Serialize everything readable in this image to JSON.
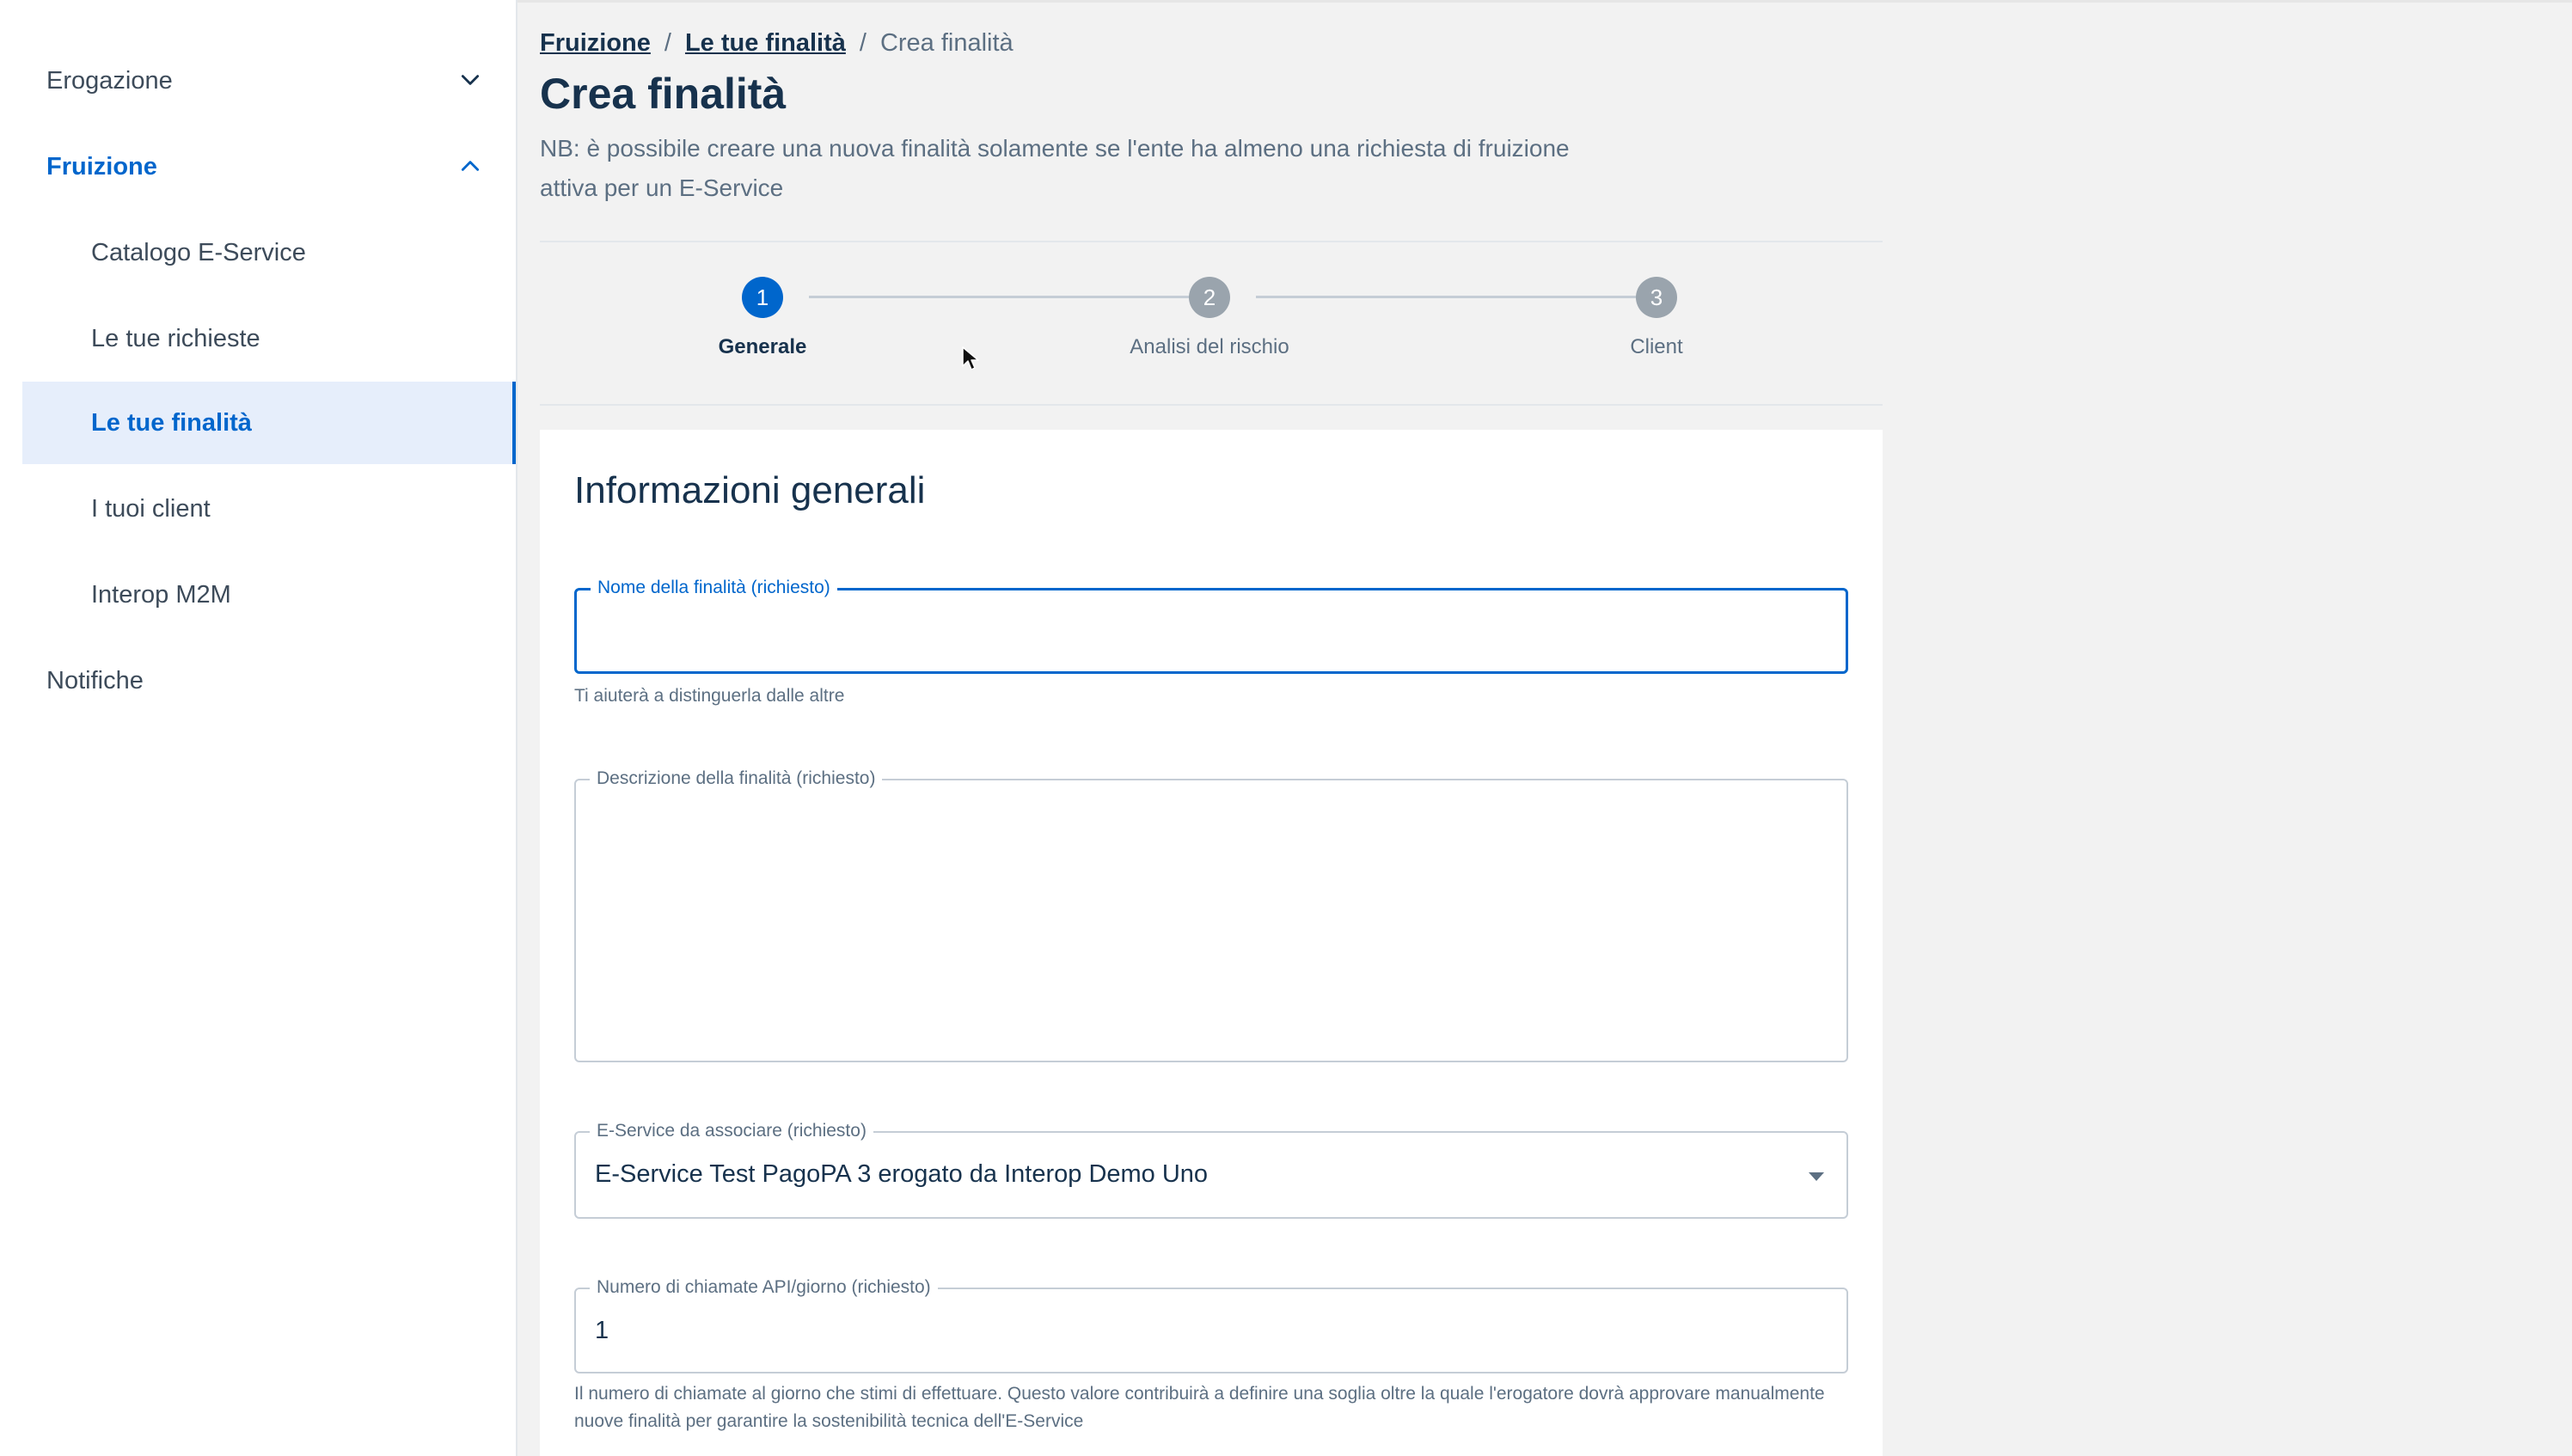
{
  "sidebar": {
    "items": [
      {
        "label": "Erogazione"
      },
      {
        "label": "Fruizione"
      },
      {
        "label": "Catalogo E-Service"
      },
      {
        "label": "Le tue richieste"
      },
      {
        "label": "Le tue finalità"
      },
      {
        "label": "I tuoi client"
      },
      {
        "label": "Interop M2M"
      },
      {
        "label": "Notifiche"
      }
    ]
  },
  "breadcrumb": {
    "items": [
      "Fruizione",
      "Le tue finalità",
      "Crea finalità"
    ],
    "separator": "/"
  },
  "page": {
    "title": "Crea finalità",
    "note": "NB: è possibile creare una nuova finalità solamente se l'ente ha almeno una richiesta di fruizione attiva per un E-Service"
  },
  "stepper": {
    "steps": [
      {
        "number": "1",
        "label": "Generale"
      },
      {
        "number": "2",
        "label": "Analisi del rischio"
      },
      {
        "number": "3",
        "label": "Client"
      }
    ],
    "active_step": 1
  },
  "form": {
    "title": "Informazioni generali",
    "name_field": {
      "label": "Nome della finalità (richiesto)",
      "value": "",
      "helper": "Ti aiuterà a distinguerla dalle altre"
    },
    "description_field": {
      "label": "Descrizione della finalità (richiesto)",
      "value": ""
    },
    "eservice_field": {
      "label": "E-Service da associare (richiesto)",
      "value": "E-Service Test PagoPA 3 erogato da Interop Demo Uno"
    },
    "calls_field": {
      "label": "Numero di chiamate API/giorno (richiesto)",
      "value": "1",
      "helper": "Il numero di chiamate al giorno che stimi di effettuare. Questo valore contribuirà a definire una soglia oltre la quale l'erogatore dovrà approvare manualmente nuove finalità per garantire la sostenibilità tecnica dell'E-Service"
    }
  },
  "colors": {
    "accent": "#0066cc",
    "text": "#17324d",
    "muted": "#5c6f82",
    "background": "#f2f2f2",
    "active_nav_bg": "#e6eefb"
  },
  "icons": {
    "erogazione": "chevron-down-icon",
    "fruizione": "chevron-up-icon",
    "eservice_select": "caret-down-icon"
  }
}
